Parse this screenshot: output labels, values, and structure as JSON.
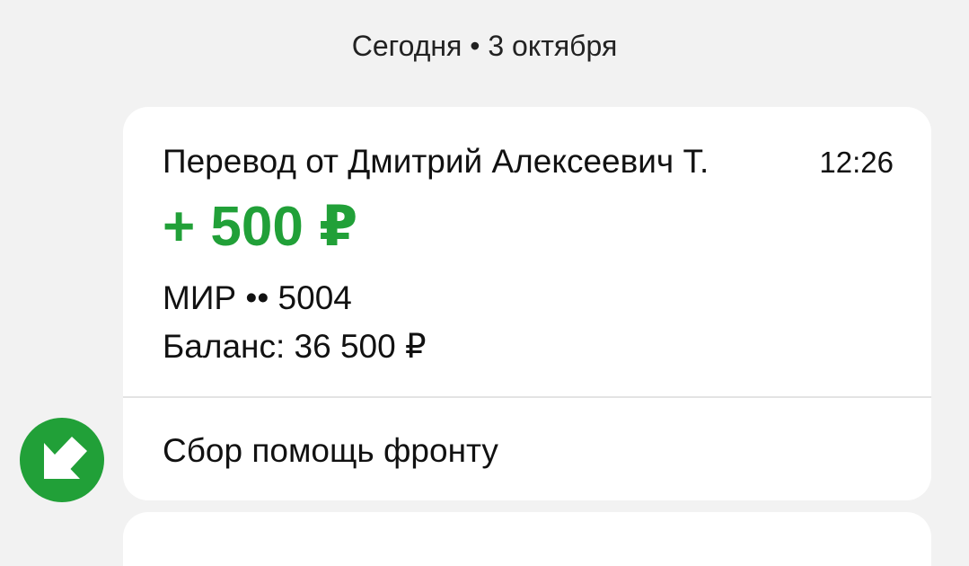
{
  "date_header": "Сегодня • 3 октября",
  "transaction": {
    "title": "Перевод от Дмитрий Алексеевич Т.",
    "time": "12:26",
    "amount": "+ 500 ₽",
    "account": "МИР •• 5004",
    "balance": "Баланс: 36 500 ₽",
    "message": "Сбор помощь фронту"
  },
  "icons": {
    "incoming": "arrow-down-left-icon"
  },
  "colors": {
    "background": "#f2f2f2",
    "card": "#ffffff",
    "accent_green": "#21a038",
    "divider": "#e3e3e3"
  }
}
